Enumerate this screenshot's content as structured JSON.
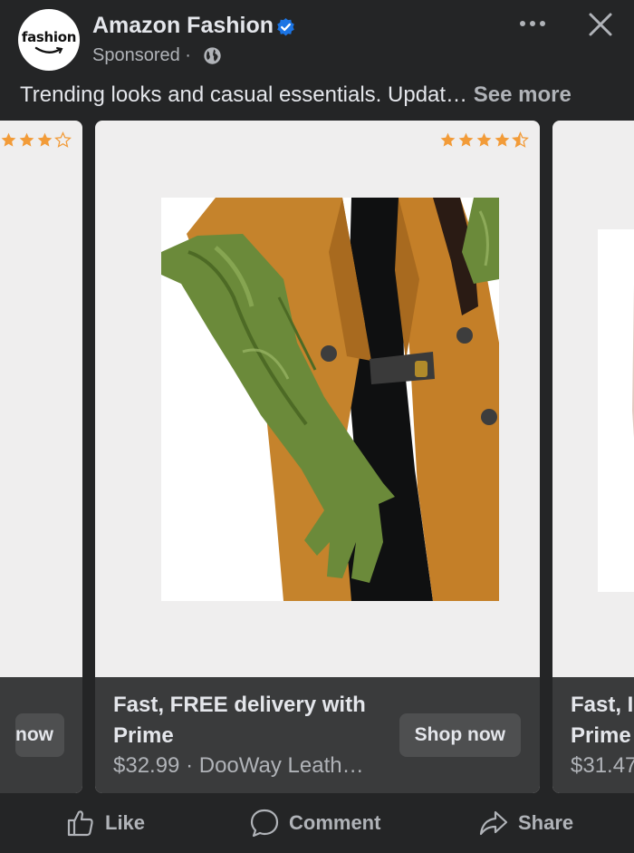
{
  "post": {
    "page_name": "Amazon Fashion",
    "sponsored_label": "Sponsored ·",
    "avatar_text": "fashion",
    "caption": "Trending looks and casual essentials. Updat…",
    "see_more": "See more"
  },
  "icons": {
    "verified": "verified-badge-icon",
    "privacy": "globe-icon",
    "more": "more-options-icon",
    "close": "close-icon",
    "like": "thumbs-up-icon",
    "comment": "comment-bubble-icon",
    "share": "share-arrow-icon"
  },
  "carousel": {
    "left_card": {
      "shop_label": "now",
      "rating": 4
    },
    "main_card": {
      "title": "Fast, FREE delivery with Prime",
      "price": "$32.99",
      "separator": " · ",
      "seller": "DooWay Leath…",
      "shop_label": "Shop now",
      "rating": 4.5
    },
    "right_card": {
      "title_line1": "Fast, I",
      "title_line2": "Prime",
      "price": "$31.47"
    }
  },
  "actions": {
    "like": "Like",
    "comment": "Comment",
    "share": "Share"
  },
  "colors": {
    "background": "#242526",
    "card_footer": "#3a3b3c",
    "verified_blue": "#1b74e4",
    "star_orange": "#f29b38",
    "secondary_text": "#b0b3b8"
  }
}
